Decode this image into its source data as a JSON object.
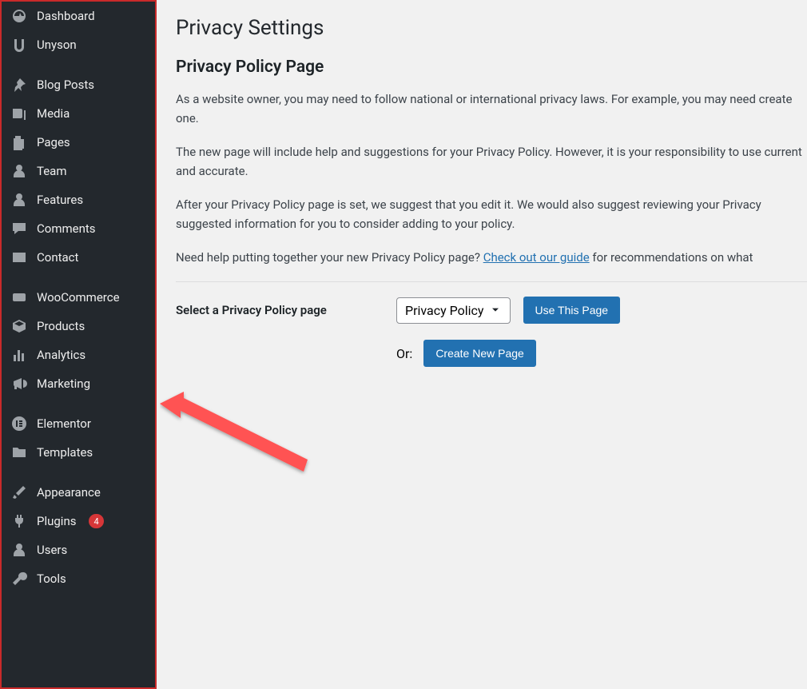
{
  "sidebar": {
    "items": [
      {
        "label": "Dashboard",
        "icon": "dashboard-icon"
      },
      {
        "label": "Unyson",
        "icon": "unyson-icon"
      },
      {
        "label": "Blog Posts",
        "icon": "pin-icon",
        "spacer_before": true
      },
      {
        "label": "Media",
        "icon": "media-icon"
      },
      {
        "label": "Pages",
        "icon": "pages-icon"
      },
      {
        "label": "Team",
        "icon": "person-icon"
      },
      {
        "label": "Features",
        "icon": "person-icon"
      },
      {
        "label": "Comments",
        "icon": "comment-icon"
      },
      {
        "label": "Contact",
        "icon": "mail-icon"
      },
      {
        "label": "WooCommerce",
        "icon": "woo-icon",
        "spacer_before": true
      },
      {
        "label": "Products",
        "icon": "product-icon"
      },
      {
        "label": "Analytics",
        "icon": "analytics-icon"
      },
      {
        "label": "Marketing",
        "icon": "megaphone-icon"
      },
      {
        "label": "Elementor",
        "icon": "elementor-icon",
        "spacer_before": true
      },
      {
        "label": "Templates",
        "icon": "folder-icon"
      },
      {
        "label": "Appearance",
        "icon": "brush-icon",
        "spacer_before": true
      },
      {
        "label": "Plugins",
        "icon": "plugin-icon",
        "badge": "4"
      },
      {
        "label": "Users",
        "icon": "person-icon"
      },
      {
        "label": "Tools",
        "icon": "wrench-icon"
      }
    ]
  },
  "main": {
    "heading": "Privacy Settings",
    "subheading": "Privacy Policy Page",
    "para1": "As a website owner, you may need to follow national or international privacy laws. For example, you may need create one.",
    "para2": "The new page will include help and suggestions for your Privacy Policy. However, it is your responsibility to use current and accurate.",
    "para3": "After your Privacy Policy page is set, we suggest that you edit it. We would also suggest reviewing your Privacy suggested information for you to consider adding to your policy.",
    "para4_pre": "Need help putting together your new Privacy Policy page? ",
    "para4_link": "Check out our guide",
    "para4_post": " for recommendations on what",
    "select_label": "Select a Privacy Policy page",
    "select_value": "Privacy Policy",
    "use_btn": "Use This Page",
    "or_label": "Or:",
    "create_btn": "Create New Page"
  }
}
